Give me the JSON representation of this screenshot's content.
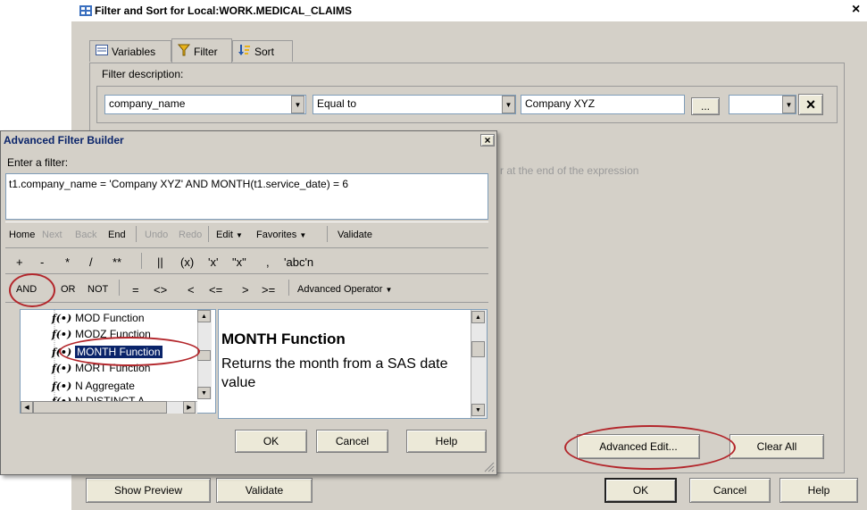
{
  "main_window": {
    "title": "Filter and Sort for Local:WORK.MEDICAL_CLAIMS",
    "close_glyph": "×",
    "tabs": [
      {
        "label": "Variables",
        "icon": "variables-icon"
      },
      {
        "label": "Filter",
        "icon": "filter-funnel-icon"
      },
      {
        "label": "Sort",
        "icon": "sort-icon"
      }
    ],
    "filter_description_label": "Filter description:",
    "filter_row": {
      "column": "company_name",
      "operator": "Equal to",
      "value": "Company XYZ",
      "ellipsis_label": "...",
      "connector": "",
      "delete_glyph": "×"
    },
    "hint_text": "r at the end of the expression",
    "buttons": {
      "advanced_edit": "Advanced Edit...",
      "clear_all": "Clear All",
      "show_preview": "Show Preview",
      "validate": "Validate",
      "ok": "OK",
      "cancel": "Cancel",
      "help": "Help"
    }
  },
  "advanced_filter_builder": {
    "title": "Advanced Filter Builder",
    "close_glyph": "×",
    "enter_filter_label": "Enter a filter:",
    "expression": "t1.company_name = 'Company XYZ' AND MONTH(t1.service_date) = 6",
    "nav_toolbar": {
      "home": "Home",
      "next": "Next",
      "back": "Back",
      "end": "End",
      "undo": "Undo",
      "redo": "Redo",
      "edit": "Edit",
      "favorites": "Favorites",
      "validate": "Validate"
    },
    "operator_row1": [
      "+",
      "-",
      "*",
      "/",
      "**",
      "||",
      "(x)",
      "'x'",
      "\"x\"",
      ",",
      "'abc'n"
    ],
    "operator_row2_logic": [
      "AND",
      "OR",
      "NOT"
    ],
    "operator_row2_compare": [
      "=",
      "<>",
      "<",
      "<=",
      ">",
      ">="
    ],
    "advanced_operator": "Advanced Operator",
    "function_list": [
      {
        "label": "MOD Function",
        "selected": false
      },
      {
        "label": "MODZ Function",
        "selected": false
      },
      {
        "label": "MONTH Function",
        "selected": true
      },
      {
        "label": "MORT Function",
        "selected": false
      },
      {
        "label": "N Aggregate",
        "selected": false
      },
      {
        "label": "N DISTINCT A",
        "selected": false
      }
    ],
    "description_title": "MONTH Function",
    "description_text": "Returns the month from a SAS date value",
    "buttons": {
      "ok": "OK",
      "cancel": "Cancel",
      "help": "Help"
    }
  }
}
